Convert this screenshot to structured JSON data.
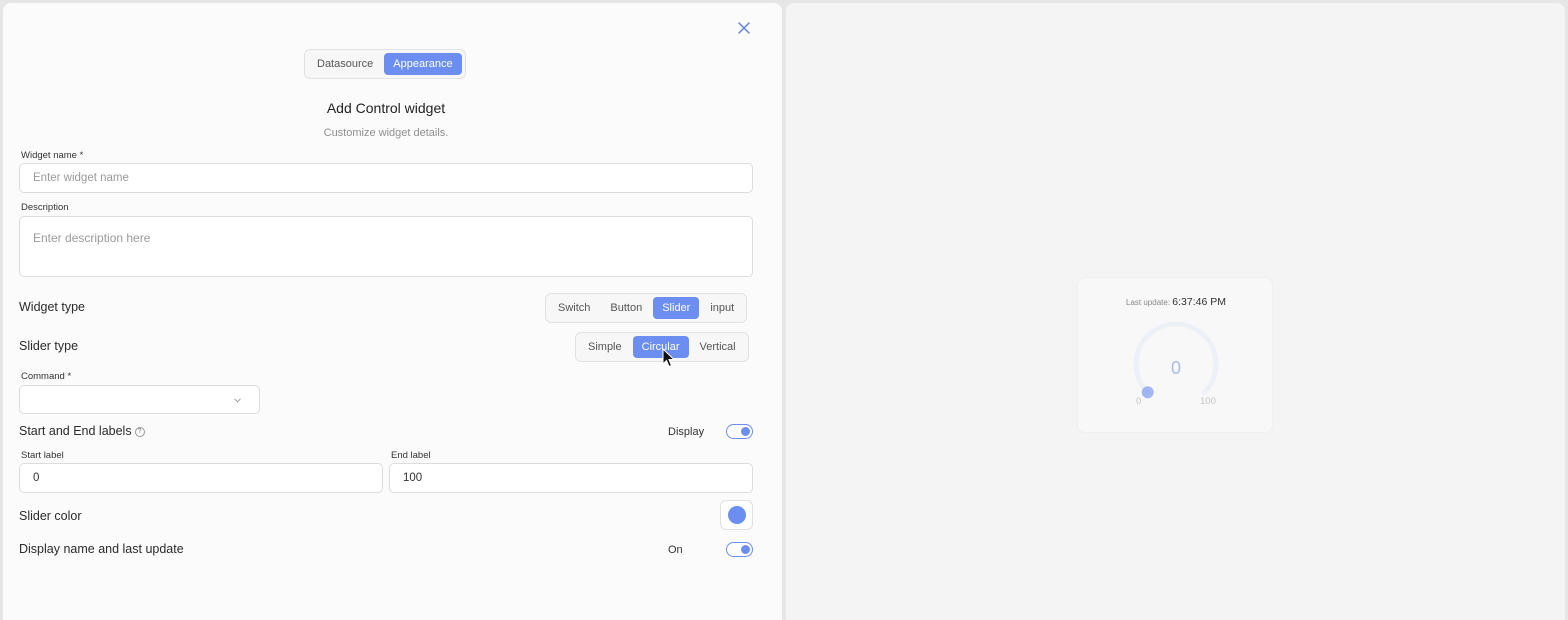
{
  "tabs": [
    {
      "label": "Datasource",
      "active": false
    },
    {
      "label": "Appearance",
      "active": true
    }
  ],
  "header": {
    "title": "Add Control widget",
    "subtitle": "Customize widget details."
  },
  "widget_name": {
    "label": "Widget name",
    "required_mark": "*",
    "placeholder": "Enter widget name"
  },
  "description": {
    "label": "Description",
    "placeholder": "Enter description here"
  },
  "widget_type": {
    "label": "Widget type",
    "options": [
      "Switch",
      "Button",
      "Slider",
      "input"
    ],
    "selected": "Slider"
  },
  "slider_type": {
    "label": "Slider type",
    "options": [
      "Simple",
      "Circular",
      "Vertical"
    ],
    "selected": "Circular"
  },
  "command": {
    "label": "Command",
    "required_mark": "*",
    "value": ""
  },
  "start_end_labels": {
    "label": "Start and End labels",
    "help": "?",
    "display_label": "Display",
    "display_on": true
  },
  "start_label": {
    "label": "Start label",
    "value": "0"
  },
  "end_label": {
    "label": "End label",
    "value": "100"
  },
  "slider_color": {
    "label": "Slider color",
    "color": "#6b8ef0"
  },
  "display_name": {
    "label": "Display name and last update",
    "state_label": "On",
    "on": true
  },
  "preview": {
    "last_update_label": "Last update:",
    "last_update_time": "6:37:46 PM",
    "value": "0",
    "min": "0",
    "max": "100",
    "value_fraction": 0
  },
  "colors": {
    "accent": "#6b8ef0",
    "gauge_track": "#edf0f7"
  }
}
